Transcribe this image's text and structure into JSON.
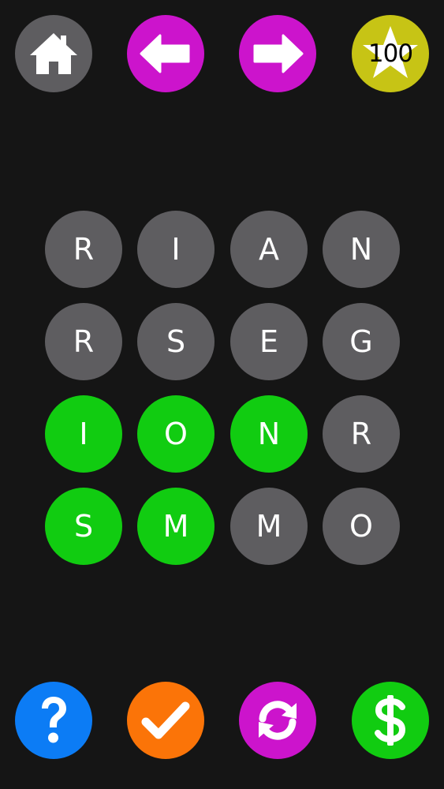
{
  "colors": {
    "background": "#151515",
    "tile_idle": "#5e5d60",
    "tile_selected": "#11cc11",
    "home_button": "#5e5d60",
    "nav_button": "#cc14cc",
    "coin_badge": "#c7c415",
    "help_button": "#0c7cf5",
    "check_button": "#fb7408",
    "shuffle_button": "#cc14cc",
    "shop_button": "#11cc11",
    "icon": "#ffffff"
  },
  "top_bar": {
    "home_icon": "house-icon",
    "back_icon": "arrow-left-icon",
    "forward_icon": "arrow-right-icon",
    "coin_icon": "star-icon",
    "coins": "100"
  },
  "bottom_bar": {
    "help_icon": "question-mark-icon",
    "check_icon": "checkmark-icon",
    "shuffle_icon": "refresh-icon",
    "shop_icon": "dollar-sign-icon"
  },
  "grid": {
    "rows": 4,
    "cols": 4,
    "tiles": [
      {
        "letter": "R",
        "selected": false
      },
      {
        "letter": "I",
        "selected": false
      },
      {
        "letter": "A",
        "selected": false
      },
      {
        "letter": "N",
        "selected": false
      },
      {
        "letter": "R",
        "selected": false
      },
      {
        "letter": "S",
        "selected": false
      },
      {
        "letter": "E",
        "selected": false
      },
      {
        "letter": "G",
        "selected": false
      },
      {
        "letter": "I",
        "selected": true
      },
      {
        "letter": "O",
        "selected": true
      },
      {
        "letter": "N",
        "selected": true
      },
      {
        "letter": "R",
        "selected": false
      },
      {
        "letter": "S",
        "selected": true
      },
      {
        "letter": "M",
        "selected": true
      },
      {
        "letter": "M",
        "selected": false
      },
      {
        "letter": "O",
        "selected": false
      }
    ]
  }
}
